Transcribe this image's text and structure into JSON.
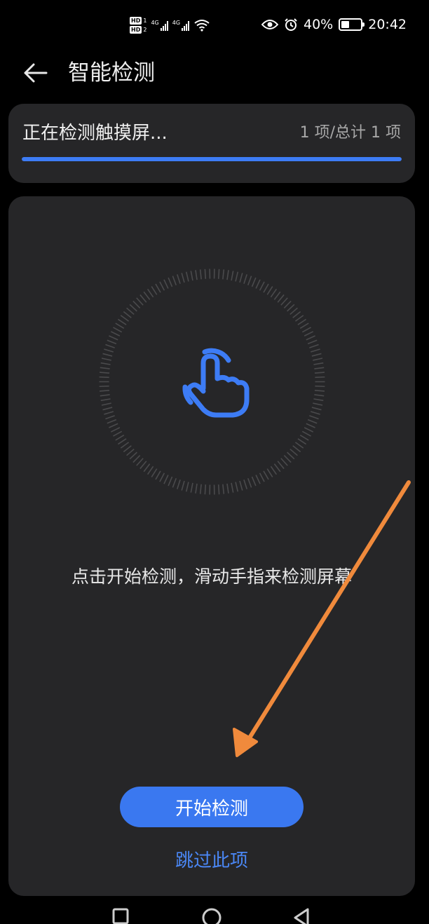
{
  "status_bar": {
    "hd1": "HD",
    "hd1_num": "1",
    "hd2": "HD",
    "hd2_num": "2",
    "net1": "4G",
    "net2": "4G",
    "battery_percent": "40%",
    "battery_level": 0.4,
    "time": "20:42",
    "icons": [
      "eye-icon",
      "alarm-icon",
      "wifi-icon",
      "battery-icon"
    ]
  },
  "header": {
    "title": "智能检测",
    "back_icon": "back-arrow-icon"
  },
  "progress": {
    "title": "正在检测触摸屏...",
    "count": "1 项/总计 1 项",
    "fraction": 1.0
  },
  "main": {
    "icon": "touch-hand-icon",
    "instruction": "点击开始检测，滑动手指来检测屏幕",
    "start_button": "开始检测",
    "skip_link": "跳过此项"
  },
  "nav": {
    "items": [
      "recent-apps-icon",
      "home-icon",
      "back-icon"
    ]
  },
  "colors": {
    "accent": "#3a78f0",
    "card_bg": "#262628",
    "page_bg": "#000000",
    "annotation": "#f08a3c"
  }
}
